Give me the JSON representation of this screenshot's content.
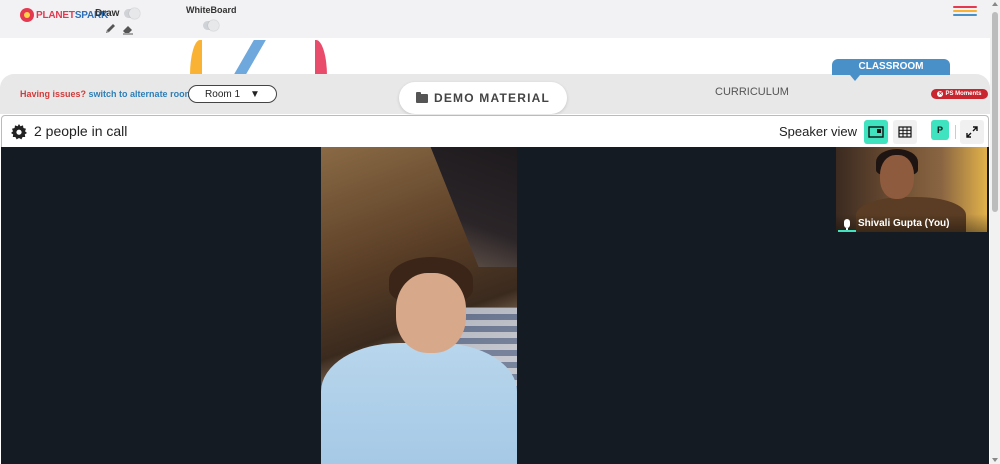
{
  "toolbar": {
    "logo_text_1": "PLANET",
    "logo_text_2": "SPARK",
    "draw_label": "Draw",
    "whiteboard_label": "WhiteBoard"
  },
  "room": {
    "issues_text": "Having issues?",
    "switch_text": "switch to alternate room",
    "selected_room": "Room 1"
  },
  "tabs": {
    "demo_material": "DEMO MATERIAL",
    "curriculum": "CURRICULUM",
    "classroom": "CLASSROOM",
    "ps_moments": "PS Moments"
  },
  "call": {
    "people_count_text": "2 people in call",
    "view_label": "Speaker view",
    "participant_badge": "P",
    "self_name": "Shivali Gupta (You)"
  },
  "colors": {
    "accent": "#3fe3c0",
    "brand_red": "#e53950",
    "classroom_blue": "#4a90c8",
    "video_bg": "#151b22"
  },
  "icons": {
    "settings": "gear-icon",
    "pencil": "pencil-icon",
    "eraser": "eraser-icon",
    "folder": "folder-icon",
    "menu": "hamburger-menu-icon",
    "speaker_view": "speaker-view-icon",
    "grid_view": "grid-view-icon",
    "fullscreen": "fullscreen-icon",
    "mic": "mic-icon"
  }
}
